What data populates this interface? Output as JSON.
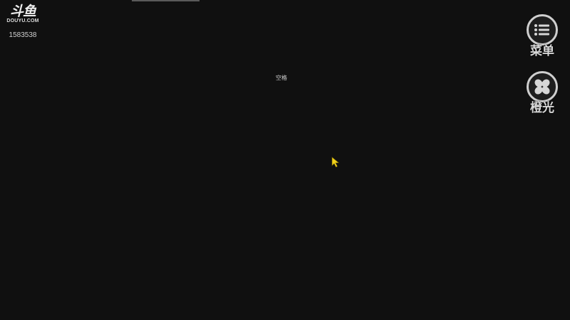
{
  "overlay": {
    "logo_mark": "斗鱼",
    "logo_domain": "DOUYU.COM",
    "room_id": "1583538"
  },
  "screen": {
    "key_hint": "空格"
  },
  "side_buttons": {
    "menu": {
      "label": "菜单",
      "icon": "menu-list-icon"
    },
    "light": {
      "label": "橙光",
      "icon": "fan-icon"
    }
  },
  "colors": {
    "background": "#101010",
    "cursor": "#f2d21b"
  }
}
